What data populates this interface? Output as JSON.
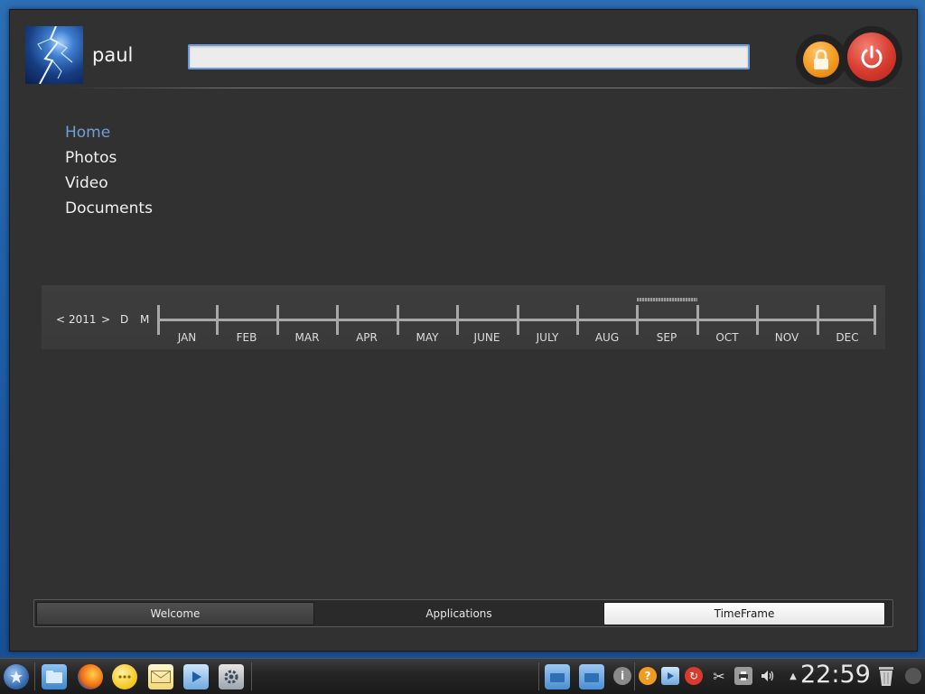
{
  "user": {
    "name": "paul"
  },
  "search": {
    "value": "",
    "placeholder": ""
  },
  "nav": {
    "items": [
      {
        "label": "Home",
        "active": true
      },
      {
        "label": "Photos",
        "active": false
      },
      {
        "label": "Video",
        "active": false
      },
      {
        "label": "Documents",
        "active": false
      }
    ]
  },
  "timeline": {
    "prev": "<",
    "year": "2011",
    "next": ">",
    "mode_day": "D",
    "mode_month": "M",
    "months": [
      "JAN",
      "FEB",
      "MAR",
      "APR",
      "MAY",
      "JUNE",
      "JULY",
      "AUG",
      "SEP",
      "OCT",
      "NOV",
      "DEC"
    ],
    "highlighted_month": "SEP"
  },
  "tabs": [
    {
      "label": "Welcome",
      "active": false
    },
    {
      "label": "Applications",
      "active": false
    },
    {
      "label": "TimeFrame",
      "active": true
    }
  ],
  "taskbar": {
    "clock": "22:59",
    "launchers": [
      "kde-menu-icon",
      "file-manager-icon",
      "firefox-icon",
      "chat-icon",
      "mail-icon",
      "media-player-icon",
      "system-settings-icon"
    ],
    "tray": [
      "folder-icon",
      "folder-icon",
      "info-icon",
      "help-icon",
      "media-icon",
      "update-icon",
      "scissors-icon",
      "printer-icon",
      "volume-icon",
      "expand-tray-icon",
      "trash-icon"
    ]
  },
  "colors": {
    "accent": "#6f9ed9",
    "panel": "#313131",
    "desktop": "#1f5ea6",
    "lock": "#f39b20",
    "power": "#d63b2e"
  }
}
